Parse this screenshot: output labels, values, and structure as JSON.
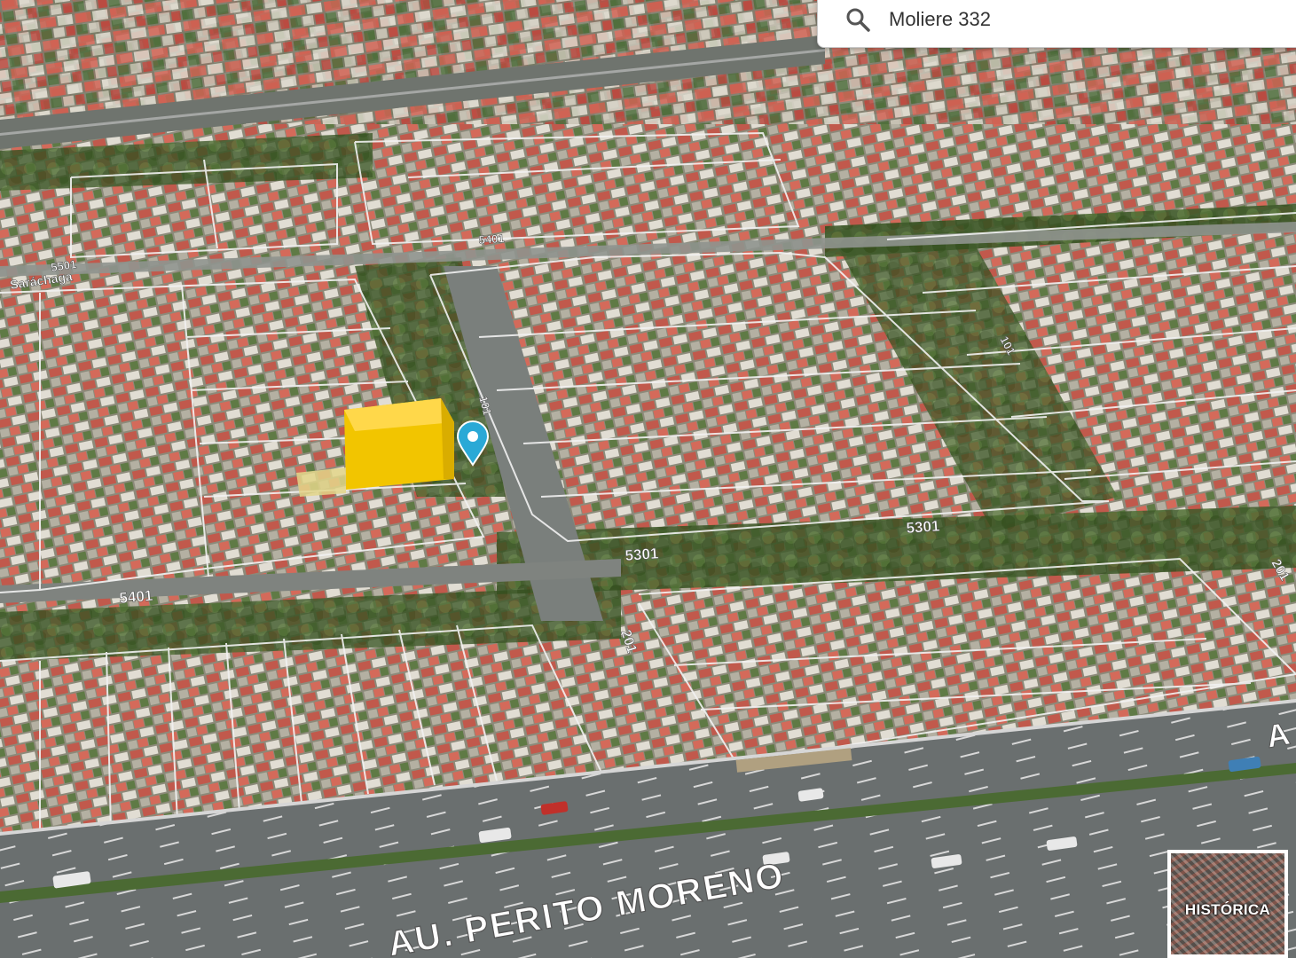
{
  "search": {
    "value": "Moliere 332",
    "icon": "search-icon"
  },
  "map": {
    "view": "3D aerial satellite",
    "street_labels": [
      "Saráchaga",
      "5501",
      "5401",
      "5401",
      "5301",
      "5301",
      "101",
      "201",
      "201",
      "101",
      "AU. PERITO MORENO",
      "A"
    ],
    "marker_icon": "location-pin-icon",
    "highlighted_parcel_color": "#f2c500",
    "pin_color": "#2aa9d6"
  },
  "historic_button": {
    "label": "HISTÓRICA"
  }
}
